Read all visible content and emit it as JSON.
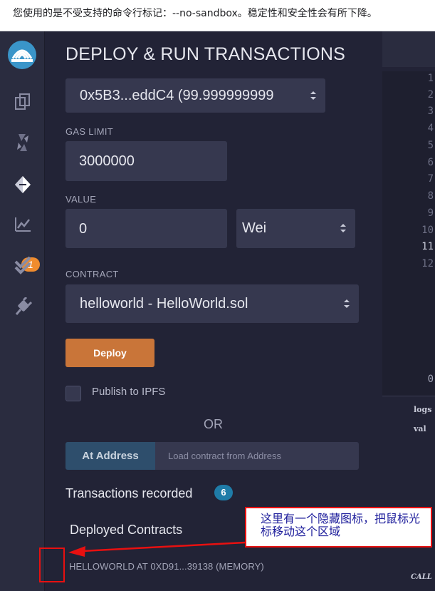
{
  "browser_warning": "您使用的是不受支持的命令行标记：--no-sandbox。稳定性和安全性会有所下降。",
  "sidebar": {
    "icons": [
      "remix-logo-icon",
      "file-explorer-icon",
      "compiler-icon",
      "deploy-run-icon",
      "analysis-icon",
      "testing-icon",
      "plugin-manager-icon"
    ],
    "analysis_badge": "1"
  },
  "panel": {
    "title": "DEPLOY & RUN TRANSACTIONS",
    "account_value": "0x5B3...eddC4 (99.999999999",
    "gas_limit_label": "GAS LIMIT",
    "gas_limit_value": "3000000",
    "value_label": "VALUE",
    "value_amount": "0",
    "value_unit": "Wei",
    "contract_label": "CONTRACT",
    "contract_value": "helloworld - HelloWorld.sol",
    "deploy_label": "Deploy",
    "publish_ipfs_label": "Publish to IPFS",
    "or_label": "OR",
    "at_address_label": "At Address",
    "at_address_placeholder": "Load contract from Address",
    "tx_recorded_label": "Transactions recorded",
    "tx_recorded_count": "6",
    "deployed_contracts_label": "Deployed Contracts",
    "deployed_instance_label": "HELLOWORLD AT 0XD91...39138 (MEMORY)"
  },
  "editor": {
    "line_numbers": [
      "1",
      "2",
      "3",
      "4",
      "5",
      "6",
      "7",
      "8",
      "9",
      "10",
      "11",
      "12"
    ],
    "active_line": "11",
    "terminal_count": "0",
    "terminal_lines": [
      "logs",
      "val"
    ],
    "terminal_call": "CALL"
  },
  "annotation": {
    "text": "这里有一个隐藏图标，把鼠标光标移动这个区域",
    "color": "#e81010"
  }
}
